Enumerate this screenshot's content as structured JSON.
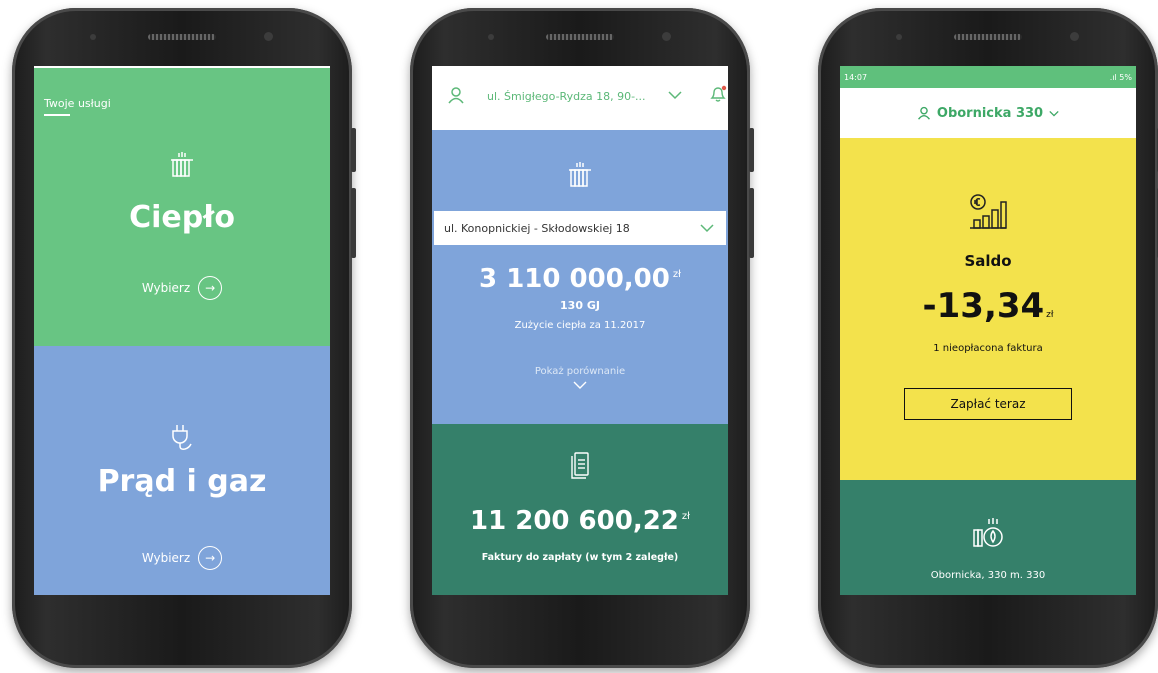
{
  "colors": {
    "green": "#68c583",
    "blue": "#7fa4da",
    "dark_green": "#35806a",
    "yellow": "#f3e24c",
    "white": "#ffffff"
  },
  "phone1": {
    "services_label": "Twoje usługi",
    "heat": {
      "icon": "radiator-icon",
      "title": "Ciepło",
      "choose_label": "Wybierz"
    },
    "power_gas": {
      "icon": "plug-icon",
      "title": "Prąd i gaz",
      "choose_label": "Wybierz"
    }
  },
  "phone2": {
    "header": {
      "address": "ul. Śmigłego-Rydza 18, 90-...",
      "icons": [
        "user-icon",
        "chevron-down-icon",
        "bell-icon"
      ]
    },
    "heat": {
      "icon": "radiator-icon",
      "selected_address": "ul. Konopnickiej - Skłodowskiej 18",
      "amount": "3 110 000,00",
      "currency": "zł",
      "units": "130 GJ",
      "caption": "Zużycie ciepła za 11.2017",
      "compare_label": "Pokaż porównanie"
    },
    "invoices": {
      "icon": "documents-icon",
      "amount": "11 200 600,22",
      "currency": "zł",
      "caption": "Faktury do zapłaty (w tym 2 zaległe)"
    }
  },
  "phone3": {
    "status_bar": {
      "time": "14:07",
      "right": ".ıl 5%"
    },
    "header": {
      "location": "Obornicka 330"
    },
    "balance": {
      "icon": "balance-chart-icon",
      "title": "Saldo",
      "amount": "-13,34",
      "currency": "zł",
      "caption": "1 nieopłacona faktura",
      "pay_button": "Zapłać teraz"
    },
    "footer": {
      "icon": "heating-icon",
      "address": "Obornicka, 330 m. 330"
    }
  }
}
